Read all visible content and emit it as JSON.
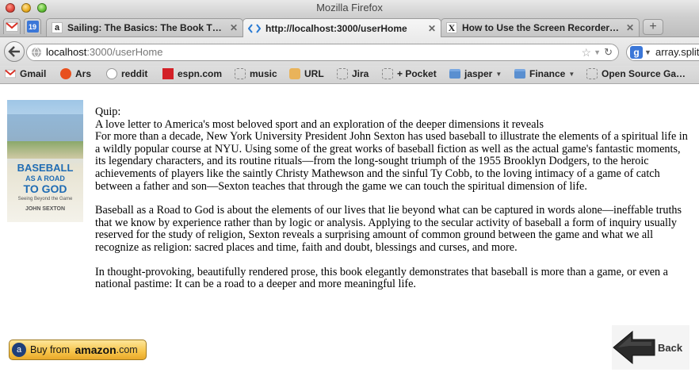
{
  "window": {
    "title": "Mozilla Firefox"
  },
  "tabs": {
    "pinned": [
      {
        "icon": "gmail-icon",
        "color": "#d93025"
      },
      {
        "icon": "calendar-icon",
        "label": "19",
        "color": "#3b77d8"
      }
    ],
    "items": [
      {
        "label": "Sailing: The Basics: The Book Th…",
        "icon": "amazon-icon",
        "close": "✕"
      },
      {
        "label": "http://localhost:3000/userHome",
        "icon": "dev-icon",
        "close": "✕"
      },
      {
        "label": "How to Use the Screen Recorder…",
        "icon": "x-icon",
        "close": "✕"
      }
    ],
    "new_tab": "+"
  },
  "nav": {
    "url_host": "localhost",
    "url_path": ":3000/userHome",
    "search_value": "array.split"
  },
  "bookmarks": [
    {
      "label": "Gmail",
      "icon": "gmail-icon"
    },
    {
      "label": "Ars",
      "icon": "ars-icon"
    },
    {
      "label": "reddit",
      "icon": "reddit-icon"
    },
    {
      "label": "espn.com",
      "icon": "espn-icon"
    },
    {
      "label": "music",
      "icon": "page-icon"
    },
    {
      "label": "URL",
      "icon": "url-icon"
    },
    {
      "label": "Jira",
      "icon": "page-icon"
    },
    {
      "label": "+ Pocket",
      "icon": "page-icon"
    },
    {
      "label": "jasper",
      "icon": "folder-icon",
      "caret": "▼"
    },
    {
      "label": "Finance",
      "icon": "folder-icon",
      "caret": "▼"
    },
    {
      "label": "Open Source Ga…",
      "icon": "page-icon"
    }
  ],
  "book": {
    "cover": {
      "title_line1": "BASEBALL",
      "title_line2": "AS A ROAD",
      "title_line3": "TO GOD",
      "subtitle": "Seeing Beyond the Game",
      "author": "JOHN SEXTON"
    },
    "quip_label": "Quip:",
    "paragraphs": [
      "A love letter to America's most beloved sport and an exploration of the deeper dimensions it reveals",
      "For more than a decade, New York University President John Sexton has used baseball to illustrate the elements of a spiritual life in a wildly popular course at NYU. Using some of the great works of baseball fiction as well as the actual game's fantastic moments, its legendary characters, and its routine rituals—from the long-sought triumph of the 1955 Brooklyn Dodgers, to the heroic achievements of players like the saintly Christy Mathewson and the sinful Ty Cobb, to the loving intimacy of a game of catch between a father and son—Sexton teaches that through the game we can touch the spiritual dimension of life.",
      "Baseball as a Road to God is about the elements of our lives that lie beyond what can be captured in words alone—ineffable truths that we know by experience rather than by logic or analysis. Applying to the secular activity of baseball a form of inquiry usually reserved for the study of religion, Sexton reveals a surprising amount of common ground between the game and what we all recognize as religion: sacred places and time, faith and doubt, blessings and curses, and more.",
      "In thought-provoking, beautifully rendered prose, this book elegantly demonstrates that baseball is more than a game, or even a national pastime: It can be a road to a deeper and more meaningful life."
    ]
  },
  "buy_button": {
    "prefix": "Buy from ",
    "brand": "amazon",
    "suffix": ".com"
  },
  "back_button": {
    "label": "Back"
  }
}
